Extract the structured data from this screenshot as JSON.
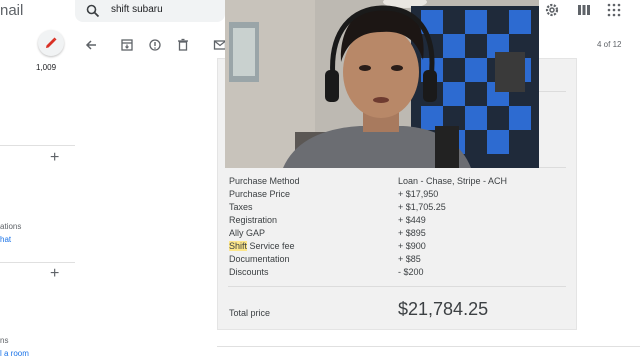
{
  "app": {
    "title": "nail"
  },
  "search": {
    "query": "shift subaru"
  },
  "sidebar": {
    "inbox_count": "1,009",
    "partial_labels": [
      "ations",
      "hat",
      "ns",
      "l a room"
    ]
  },
  "toolbar": {
    "pager": "4 of 12"
  },
  "email": {
    "rows": [
      {
        "label": "Purchase Method",
        "value": "Loan - Chase, Stripe - ACH"
      },
      {
        "label": "Purchase Price",
        "value": "+ $17,950"
      },
      {
        "label": "Taxes",
        "value": "+ $1,705.25"
      },
      {
        "label": "Registration",
        "value": "+ $449"
      },
      {
        "label": "Ally GAP",
        "value": "+ $895"
      },
      {
        "label_highlight": "Shift",
        "label_rest": " Service fee",
        "value": "+ $900"
      },
      {
        "label": "Documentation",
        "value": "+ $85"
      },
      {
        "label": "Discounts",
        "value": "- $200"
      }
    ],
    "total_label": "Total price",
    "total_value": "$21,784.25"
  },
  "colors": {
    "highlight": "#fde68a",
    "link": "#1a73e8",
    "compose_icon": "#d93025"
  },
  "icons": {
    "toolbar": [
      "back-arrow-icon",
      "archive-icon",
      "report-spam-icon",
      "delete-icon",
      "mail-icon"
    ],
    "top": [
      "settings-icon",
      "apps-icon",
      "grid-icon"
    ]
  }
}
